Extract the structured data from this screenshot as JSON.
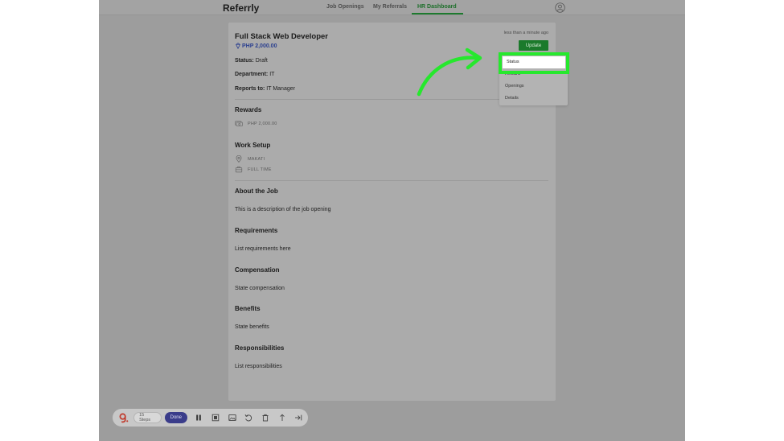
{
  "nav": {
    "brand": "Referrly",
    "links": [
      "Job Openings",
      "My Referrals",
      "HR Dashboard"
    ],
    "active": "HR Dashboard"
  },
  "job": {
    "title": "Full Stack Web Developer",
    "reward_amount": "PHP 2,000.00",
    "timestamp": "less than a minute ago",
    "update_label": "Update",
    "status_label": "Status:",
    "status_value": "Draft",
    "department_label": "Department:",
    "department_value": "IT",
    "reports_label": "Reports to:",
    "reports_value": "IT Manager"
  },
  "sections": {
    "rewards": {
      "title": "Rewards",
      "value": "PHP 2,000.00"
    },
    "work_setup": {
      "title": "Work Setup",
      "location": "MAKATI",
      "type": "FULL TIME"
    },
    "about": {
      "title": "About the Job",
      "text": "This is a description of the job opening"
    },
    "requirements": {
      "title": "Requirements",
      "text": "List requirements here"
    },
    "compensation": {
      "title": "Compensation",
      "text": "State compensation"
    },
    "benefits": {
      "title": "Benefits",
      "text": "State benefits"
    },
    "responsibilities": {
      "title": "Responsibilities",
      "text": "List responsibilities"
    }
  },
  "dropdown": {
    "items": [
      "Status",
      "Reward",
      "Openings",
      "Details"
    ],
    "highlighted": "Status"
  },
  "toolbar": {
    "steps": "15 Steps",
    "done": "Done",
    "icons": [
      "pause-icon",
      "stop-icon",
      "image-icon",
      "undo-icon",
      "trash-icon",
      "export-icon",
      "skip-icon"
    ]
  },
  "colors": {
    "accent_green": "#1b7a2b",
    "highlight_green": "#26e82d",
    "done_blue": "#3a3c8a",
    "reward_blue": "#2a3f8f"
  }
}
